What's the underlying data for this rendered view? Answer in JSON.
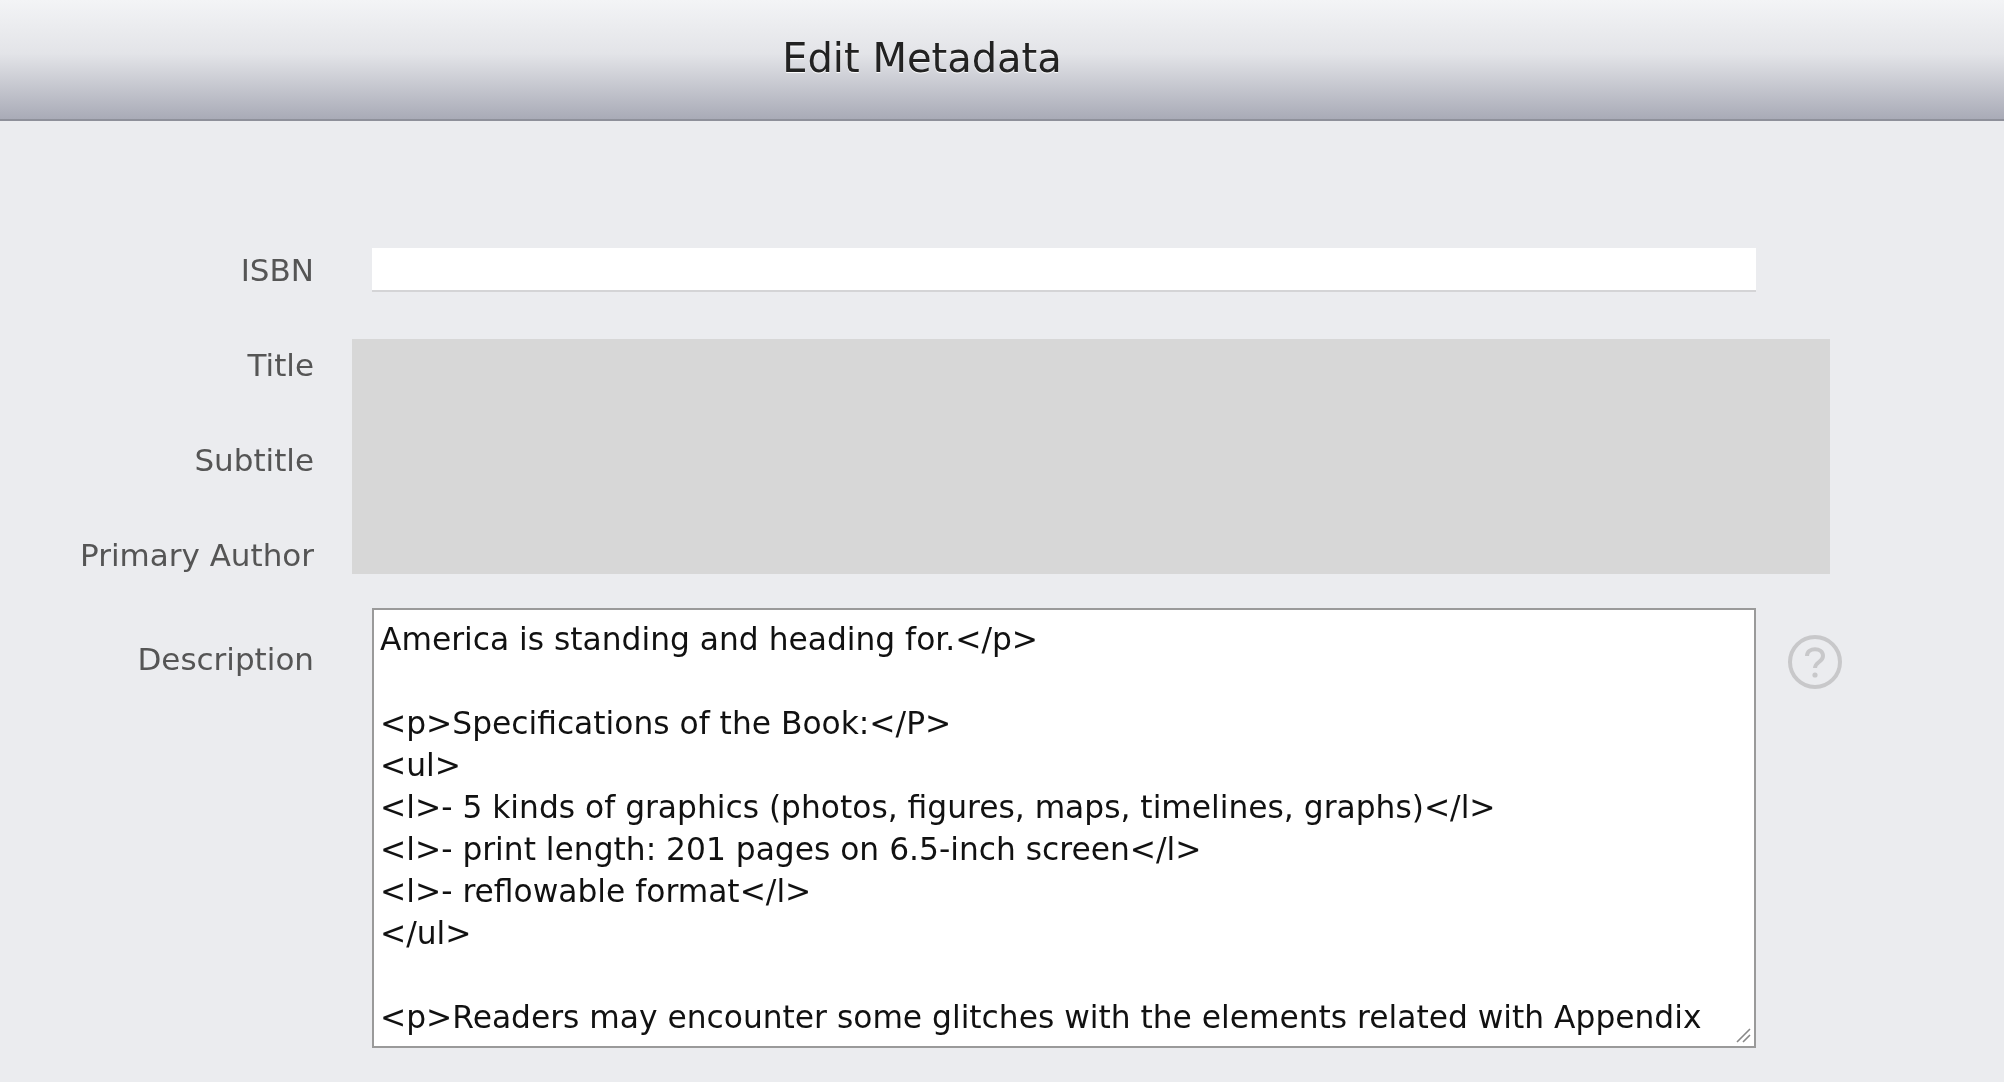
{
  "window": {
    "title": "Edit Metadata"
  },
  "fields": [
    {
      "label": "ISBN",
      "kind": "input"
    }
  ],
  "locked_fields": [
    {
      "label": "Title"
    },
    {
      "label": "Subtitle"
    },
    {
      "label": "Primary Author"
    }
  ],
  "description": {
    "label": "Description",
    "blocks": [
      [
        "America is standing and heading for.</p>"
      ],
      [
        "<p>Specifications of the Book:</P>",
        "<ul>",
        "<l>- 5 kinds of graphics (photos, figures, maps, timelines, graphs)</l>",
        "<l>- print length: 201 pages on 6.5-inch screen</l>",
        "<l>- reflowable format</l>",
        "</ul>"
      ],
      [
        "<p>Readers may encounter some glitches with the elements related with Appendix"
      ]
    ]
  }
}
